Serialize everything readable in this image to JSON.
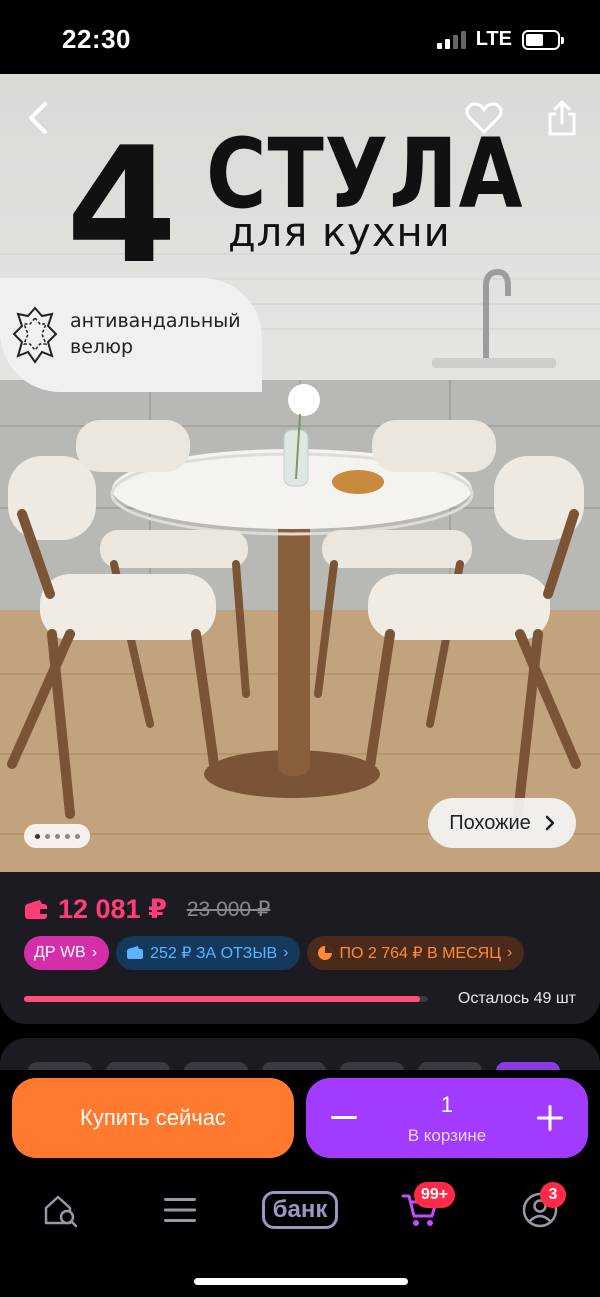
{
  "status_bar": {
    "time": "22:30",
    "network": "LTE",
    "battery_level": 0.55
  },
  "hero": {
    "title_number": "4",
    "title_word": "СТУЛА",
    "subtitle": "для кухни",
    "feature_badge": "антивандальный велюр",
    "back_icon": "chevron-left-icon",
    "favorite_icon": "heart-icon",
    "share_icon": "share-icon",
    "gallery_dots": 5,
    "similar_label": "Похожие"
  },
  "pricing": {
    "current_price": "12 081 ₽",
    "old_price": "23 000 ₽",
    "wallet_icon": "wallet-icon",
    "chips": [
      {
        "label": "ДР WB",
        "color": "#d42fa8"
      },
      {
        "label": "252 ₽ ЗА ОТЗЫВ",
        "color": "#5ab4ff"
      },
      {
        "label": "ПО 2 764 ₽ В МЕСЯЦ",
        "color": "#ff8a3a"
      }
    ],
    "stock_fraction": 0.98,
    "stock_text": "Осталось 49 шт"
  },
  "actions": {
    "buy_now_label": "Купить сейчас",
    "cart_quantity": "1",
    "cart_label": "В корзине"
  },
  "bottom_nav": {
    "items": [
      "home-search-icon",
      "menu-icon",
      "bank-logo",
      "cart-icon",
      "profile-icon"
    ],
    "bank_label": "банк",
    "cart_badge": "99+",
    "profile_badge": "3"
  },
  "colors": {
    "accent_pink": "#ff3d78",
    "buy_orange": "#ff7a2f",
    "cart_purple": "#a03bff"
  }
}
